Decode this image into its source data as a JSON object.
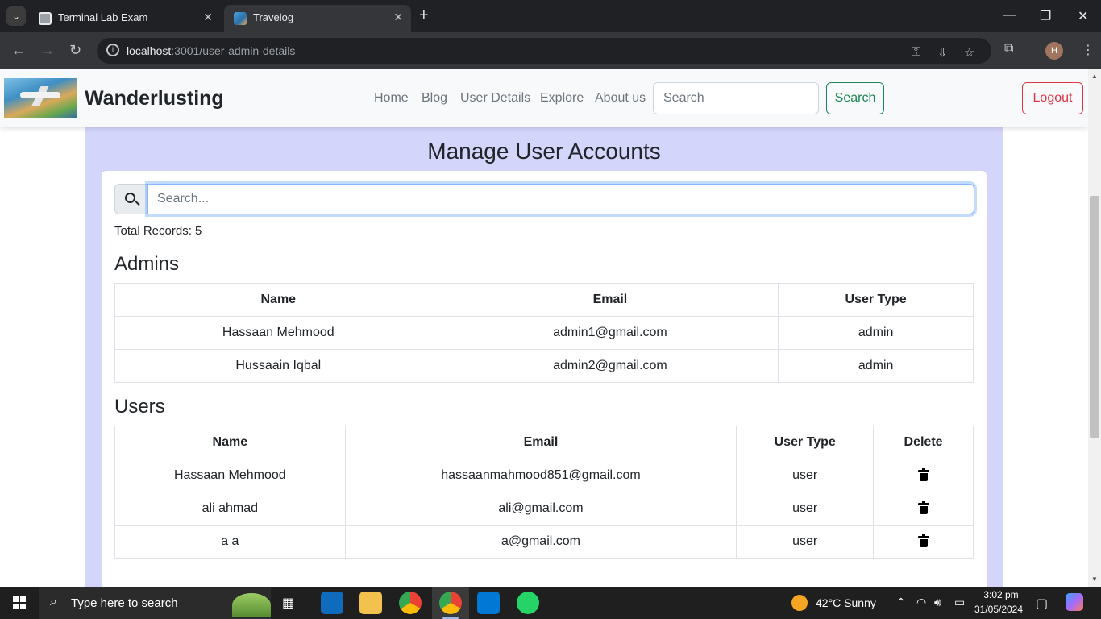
{
  "browser": {
    "tabs": [
      {
        "title": "Terminal Lab Exam"
      },
      {
        "title": "Travelog"
      }
    ],
    "url_host": "localhost",
    "url_path": ":3001/user-admin-details",
    "profile_initial": "H"
  },
  "navbar": {
    "brand": "Wanderlusting",
    "links": [
      "Home",
      "Blog",
      "User Details",
      "Explore",
      "About us"
    ],
    "search_placeholder": "Search",
    "search_button": "Search",
    "logout_button": "Logout"
  },
  "page": {
    "title": "Manage User Accounts",
    "search_placeholder": "Search...",
    "total_records": "Total Records: 5",
    "admins": {
      "heading": "Admins",
      "columns": [
        "Name",
        "Email",
        "User Type"
      ],
      "rows": [
        {
          "name": "Hassaan Mehmood",
          "email": "admin1@gmail.com",
          "type": "admin"
        },
        {
          "name": "Hussaain Iqbal",
          "email": "admin2@gmail.com",
          "type": "admin"
        }
      ]
    },
    "users": {
      "heading": "Users",
      "columns": [
        "Name",
        "Email",
        "User Type",
        "Delete"
      ],
      "rows": [
        {
          "name": "Hassaan Mehmood",
          "email": "hassaanmahmood851@gmail.com",
          "type": "user"
        },
        {
          "name": "ali ahmad",
          "email": "ali@gmail.com",
          "type": "user"
        },
        {
          "name": "a a",
          "email": "a@gmail.com",
          "type": "user"
        }
      ]
    }
  },
  "taskbar": {
    "search_placeholder": "Type here to search",
    "weather": "42°C  Sunny",
    "time": "3:02 pm",
    "date": "31/05/2024"
  },
  "colors": {
    "panel_bg": "#d4d5fb",
    "success": "#198754",
    "danger": "#dc3545",
    "browser_dark": "#202124"
  }
}
